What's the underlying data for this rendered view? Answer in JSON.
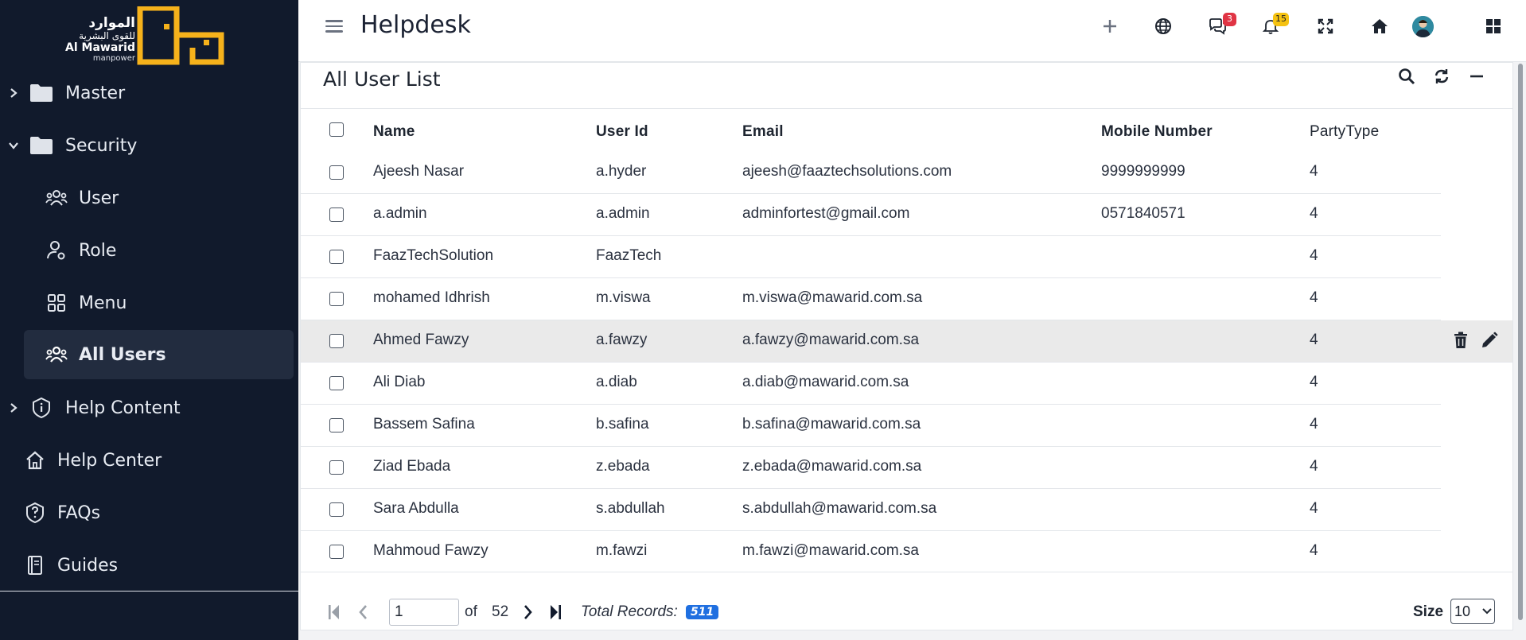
{
  "logo": {
    "arabic_line1": "الموارد",
    "arabic_line2": "للقوى البشرية",
    "english": "Al Mawarid",
    "sub": "manpower"
  },
  "sidebar": {
    "items": [
      {
        "label": "Master",
        "icon": "folder-icon",
        "expandable": true,
        "expanded": false
      },
      {
        "label": "Security",
        "icon": "folder-icon",
        "expandable": true,
        "expanded": true
      },
      {
        "label": "User",
        "icon": "users-icon",
        "sub": true
      },
      {
        "label": "Role",
        "icon": "user-gear-icon",
        "sub": true
      },
      {
        "label": "Menu",
        "icon": "grid-icon",
        "sub": true
      },
      {
        "label": "All Users",
        "icon": "users-icon",
        "sub": true,
        "active": true
      },
      {
        "label": "Help Content",
        "icon": "info-shield-icon",
        "expandable": true,
        "expanded": false
      },
      {
        "label": "Help Center",
        "icon": "home-icon"
      },
      {
        "label": "FAQs",
        "icon": "question-shield-icon"
      },
      {
        "label": "Guides",
        "icon": "book-icon"
      }
    ]
  },
  "header": {
    "title": "Helpdesk",
    "icons": [
      "plus-icon",
      "globe-icon",
      "chat-icon",
      "bell-icon",
      "fullscreen-icon",
      "home-icon",
      "avatar",
      "apps-grid-icon"
    ],
    "chat_badge": "3",
    "bell_badge": "15"
  },
  "card": {
    "title": "All User List",
    "tools": [
      "search-icon",
      "refresh-icon",
      "minimize-icon"
    ]
  },
  "table": {
    "columns": [
      "Name",
      "User Id",
      "Email",
      "Mobile Number",
      "PartyType"
    ],
    "rows": [
      {
        "name": "Ajeesh Nasar",
        "user_id": "a.hyder",
        "email": "ajeesh@faaztechsolutions.com",
        "mobile": "9999999999",
        "party_type": "4"
      },
      {
        "name": "a.admin",
        "user_id": "a.admin",
        "email": "adminfortest@gmail.com",
        "mobile": "0571840571",
        "party_type": "4"
      },
      {
        "name": "FaazTechSolution",
        "user_id": "FaazTech",
        "email": "",
        "mobile": "",
        "party_type": "4"
      },
      {
        "name": "mohamed Idhrish",
        "user_id": "m.viswa",
        "email": "m.viswa@mawarid.com.sa",
        "mobile": "",
        "party_type": "4"
      },
      {
        "name": "Ahmed Fawzy",
        "user_id": "a.fawzy",
        "email": "a.fawzy@mawarid.com.sa",
        "mobile": "",
        "party_type": "4",
        "highlighted": true
      },
      {
        "name": "Ali Diab",
        "user_id": "a.diab",
        "email": "a.diab@mawarid.com.sa",
        "mobile": "",
        "party_type": "4"
      },
      {
        "name": "Bassem Safina",
        "user_id": "b.safina",
        "email": "b.safina@mawarid.com.sa",
        "mobile": "",
        "party_type": "4"
      },
      {
        "name": "Ziad Ebada",
        "user_id": "z.ebada",
        "email": "z.ebada@mawarid.com.sa",
        "mobile": "",
        "party_type": "4"
      },
      {
        "name": "Sara Abdulla",
        "user_id": "s.abdullah",
        "email": "s.abdullah@mawarid.com.sa",
        "mobile": "",
        "party_type": "4"
      },
      {
        "name": "Mahmoud Fawzy",
        "user_id": "m.fawzi",
        "email": "m.fawzi@mawarid.com.sa",
        "mobile": "",
        "party_type": "4"
      }
    ],
    "row_actions": [
      "trash-icon",
      "pencil-icon"
    ]
  },
  "pagination": {
    "current_page": "1",
    "of_label": "of",
    "total_pages": "52",
    "total_label": "Total Records:",
    "total_records": "511",
    "size_label": "Size",
    "size_value": "10"
  },
  "colors": {
    "sidebar_bg": "#111a2c",
    "sidebar_active_bg": "#222c3f",
    "logo_accent": "#f6b21b",
    "badge_red": "#e03444",
    "badge_yellow": "#f5c211",
    "total_badge": "#1f6fe0",
    "row_highlight": "#eaeaea"
  }
}
